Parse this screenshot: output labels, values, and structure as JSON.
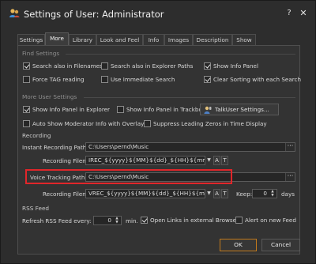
{
  "window": {
    "title": "Settings of User: Administrator",
    "help_label": "?",
    "close_label": "✕"
  },
  "tabs": [
    {
      "label": "Settings",
      "active": false
    },
    {
      "label": "More",
      "active": true
    },
    {
      "label": "Library",
      "active": false
    },
    {
      "label": "Look and Feel",
      "active": false
    },
    {
      "label": "Info",
      "active": false
    },
    {
      "label": "Images",
      "active": false
    },
    {
      "label": "Description",
      "active": false
    },
    {
      "label": "Show",
      "active": false
    }
  ],
  "find_settings": {
    "title": "Find Settings",
    "search_filenames": {
      "label": "Search also in Filenames",
      "checked": true
    },
    "search_explorer": {
      "label": "Search also in Explorer Paths",
      "checked": false
    },
    "show_info_panel": {
      "label": "Show Info Panel",
      "checked": true
    },
    "force_tag": {
      "label": "Force TAG reading",
      "checked": false
    },
    "immediate_search": {
      "label": "Use Immediate Search",
      "checked": false
    },
    "clear_sorting": {
      "label": "Clear Sorting with each Search",
      "checked": true
    }
  },
  "more_user_settings": {
    "title": "More User Settings",
    "info_explorer": {
      "label": "Show Info Panel in Explorer",
      "checked": true
    },
    "info_trackboard": {
      "label": "Show Info Panel in Trackboard",
      "checked": false
    },
    "talkuser_button": "TalkUser Settings...",
    "auto_moderator": {
      "label": "Auto Show Moderator Info with Overlay",
      "checked": false
    },
    "suppress_zeros": {
      "label": "Suppress Leading Zeros in Time Display",
      "checked": false
    }
  },
  "recording": {
    "title": "Recording",
    "instant_path_label": "Instant Recording Path:",
    "instant_path_value": "C:\\Users\\pernd\\Music",
    "rec_filename_label": "Recording Filename:",
    "rec_filename_value": "IREC_${yyyy}${MM}${dd}_${HH}${mm}${ss",
    "voice_path_label": "Voice Tracking Path:",
    "voice_path_value": "C:\\Users\\pernd\\Music",
    "voice_filename_label": "Recording Filename:",
    "voice_filename_value": "VREC_${yyyy}${MM}${dd}_${HH}${mm}${ss",
    "keep_label": "Keep:",
    "keep_value": "0",
    "days_label": "days",
    "browse": "···",
    "btn_a": "A",
    "btn_t": "T"
  },
  "rss": {
    "title": "RSS Feed",
    "refresh_label": "Refresh RSS Feed every:",
    "refresh_value": "0",
    "min_label": "min.",
    "open_links": {
      "label": "Open Links in external Browser",
      "checked": true
    },
    "alert_new": {
      "label": "Alert on new Feed",
      "checked": false
    }
  },
  "footer": {
    "ok": "OK",
    "cancel": "Cancel"
  },
  "colors": {
    "background": "#333333",
    "accent_ok": "#c27a1d",
    "highlight": "#e0262a"
  }
}
